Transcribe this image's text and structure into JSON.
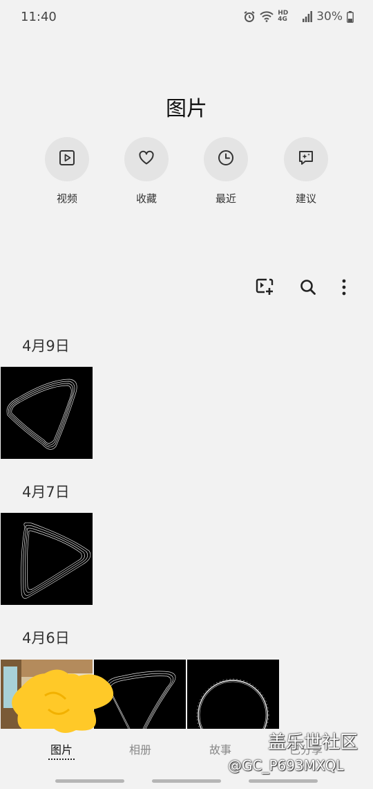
{
  "status": {
    "time": "11:40",
    "network": "HD 4G",
    "battery": "30%"
  },
  "title": "图片",
  "quick_actions": [
    {
      "label": "视频",
      "icon": "video-icon"
    },
    {
      "label": "收藏",
      "icon": "heart-icon"
    },
    {
      "label": "最近",
      "icon": "clock-icon"
    },
    {
      "label": "建议",
      "icon": "suggestion-icon"
    }
  ],
  "toolbar": {
    "icons": [
      "create-icon",
      "search-icon",
      "more-icon"
    ]
  },
  "groups": [
    {
      "date": "4月9日",
      "thumbnails": [
        "video-thumbnail"
      ]
    },
    {
      "date": "4月7日",
      "thumbnails": [
        "video-thumbnail"
      ]
    },
    {
      "date": "4月6日",
      "thumbnails": [
        "photo-thumbnail",
        "video-thumbnail",
        "video-thumbnail"
      ]
    }
  ],
  "bottom_nav": {
    "tabs": [
      {
        "label": "图片",
        "active": true
      },
      {
        "label": "相册",
        "active": false
      },
      {
        "label": "故事",
        "active": false
      },
      {
        "label": "已分享",
        "active": false
      }
    ]
  },
  "watermark": {
    "line1": "盖乐世社区",
    "line2": "@GC_P693MXQL"
  },
  "colors": {
    "background": "#f2f2f2",
    "circle": "#e4e4e4",
    "sticker": "#ffc928"
  }
}
